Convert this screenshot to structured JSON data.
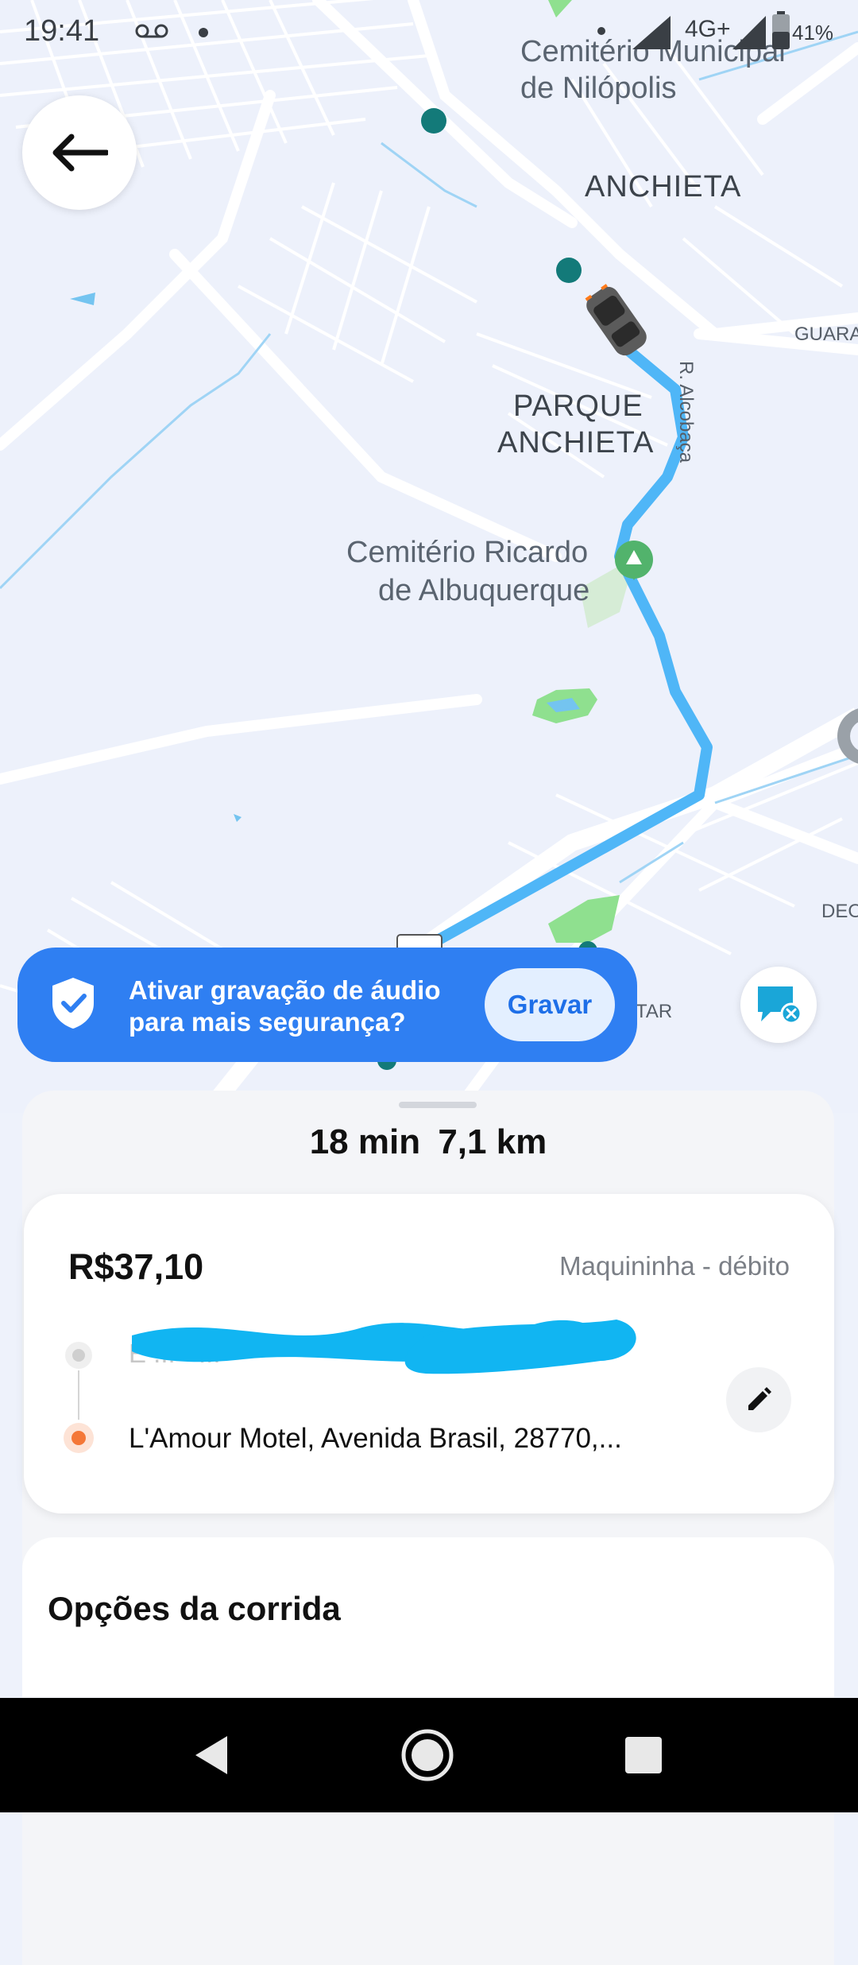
{
  "status_bar": {
    "time": "19:41",
    "network": "4G+",
    "battery": "41%",
    "icons": [
      "voicemail-icon",
      "dot-icon",
      "signal-icon",
      "battery-icon"
    ]
  },
  "map": {
    "labels": {
      "cemiterio_municipal_1": "Cemitério Municipal",
      "cemiterio_municipal_2": "de Nilópolis",
      "anchieta": "ANCHIETA",
      "parque_1": "PARQUE",
      "parque_2": "ANCHIETA",
      "guara": "GUARA",
      "alcobaca": "R. Alcobaça",
      "cemiterio_ricardo_1": "Cemitério Ricardo",
      "cemiterio_ricardo_2": "de Albuquerque",
      "deo": "DEO",
      "tar": "TAR"
    },
    "colors": {
      "route": "#4fb6f7",
      "park": "#8fe08f",
      "road": "#ffffff",
      "background": "#edf1fb"
    }
  },
  "back_button": {
    "icon": "arrow-left-icon"
  },
  "audio_banner": {
    "text": "Ativar gravação de áudio para mais segurança?",
    "button_label": "Gravar",
    "icon": "shield-check-icon",
    "color": "#2f7ff2"
  },
  "chat_button": {
    "icon": "chat-off-icon"
  },
  "trip": {
    "duration": "18 min",
    "distance": "7,1 km"
  },
  "ride_card": {
    "price": "R$37,10",
    "payment_method": "Maquininha - débito",
    "origin": "E ... - ...",
    "destination": "L'Amour Motel, Avenida Brasil, 28770,..."
  },
  "options": {
    "title": "Opções da corrida"
  },
  "navbar": {
    "back": "back-triangle-icon",
    "home": "home-circle-icon",
    "recents": "recents-square-icon"
  }
}
